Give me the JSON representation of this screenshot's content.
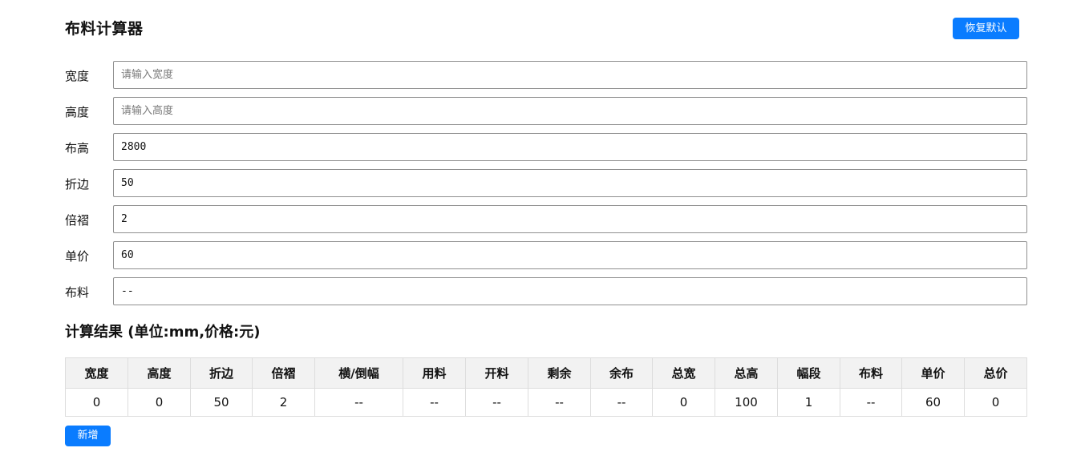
{
  "header": {
    "title": "布料计算器",
    "reset_label": "恢复默认"
  },
  "form": {
    "fields": [
      {
        "label": "宽度",
        "value": "",
        "placeholder": "请输入宽度"
      },
      {
        "label": "高度",
        "value": "",
        "placeholder": "请输入高度"
      },
      {
        "label": "布高",
        "value": "2800",
        "placeholder": ""
      },
      {
        "label": "折边",
        "value": "50",
        "placeholder": ""
      },
      {
        "label": "倍褶",
        "value": "2",
        "placeholder": ""
      },
      {
        "label": "单价",
        "value": "60",
        "placeholder": ""
      },
      {
        "label": "布料",
        "value": "--",
        "placeholder": ""
      }
    ]
  },
  "results": {
    "title": "计算结果 (单位:mm,价格:元)",
    "columns": [
      "宽度",
      "高度",
      "折边",
      "倍褶",
      "横/倒幅",
      "用料",
      "开料",
      "剩余",
      "余布",
      "总宽",
      "总高",
      "幅段",
      "布料",
      "单价",
      "总价"
    ],
    "rows": [
      [
        "0",
        "0",
        "50",
        "2",
        "--",
        "--",
        "--",
        "--",
        "--",
        "0",
        "100",
        "1",
        "--",
        "60",
        "0"
      ]
    ]
  },
  "actions": {
    "add_label": "新增"
  },
  "colors": {
    "accent": "#0a7cff",
    "table_header_bg": "#f2f2f2",
    "border": "#dddddd"
  }
}
